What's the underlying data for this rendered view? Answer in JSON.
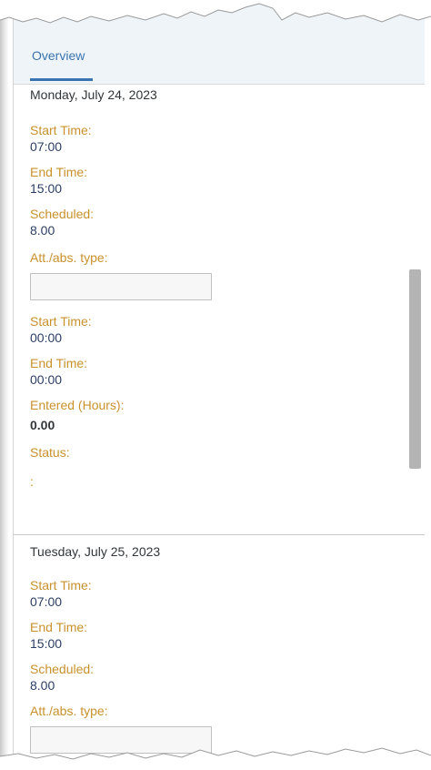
{
  "tabs": {
    "overview_label": "Overview"
  },
  "days": [
    {
      "date": "Monday, July 24, 2023",
      "start_time_label": "Start Time:",
      "start_time": "07:00",
      "end_time_label": "End Time:",
      "end_time": "15:00",
      "scheduled_label": "Scheduled:",
      "scheduled": "8.00",
      "att_abs_label": "Att./abs. type:",
      "att_abs_value": "",
      "start_time2_label": "Start Time:",
      "start_time2": "00:00",
      "end_time2_label": "End Time:",
      "end_time2": "00:00",
      "entered_label": "Entered (Hours):",
      "entered": "0.00",
      "status_label": "Status:",
      "status": ":"
    },
    {
      "date": "Tuesday, July 25, 2023",
      "start_time_label": "Start Time:",
      "start_time": "07:00",
      "end_time_label": "End Time:",
      "end_time": "15:00",
      "scheduled_label": "Scheduled:",
      "scheduled": "8.00",
      "att_abs_label": "Att./abs. type:",
      "att_abs_value": ""
    }
  ],
  "colors": {
    "label": "#c9912d",
    "value": "#2c3e66",
    "tab_active": "#3a74b0",
    "header_bg": "#eff4f9"
  }
}
